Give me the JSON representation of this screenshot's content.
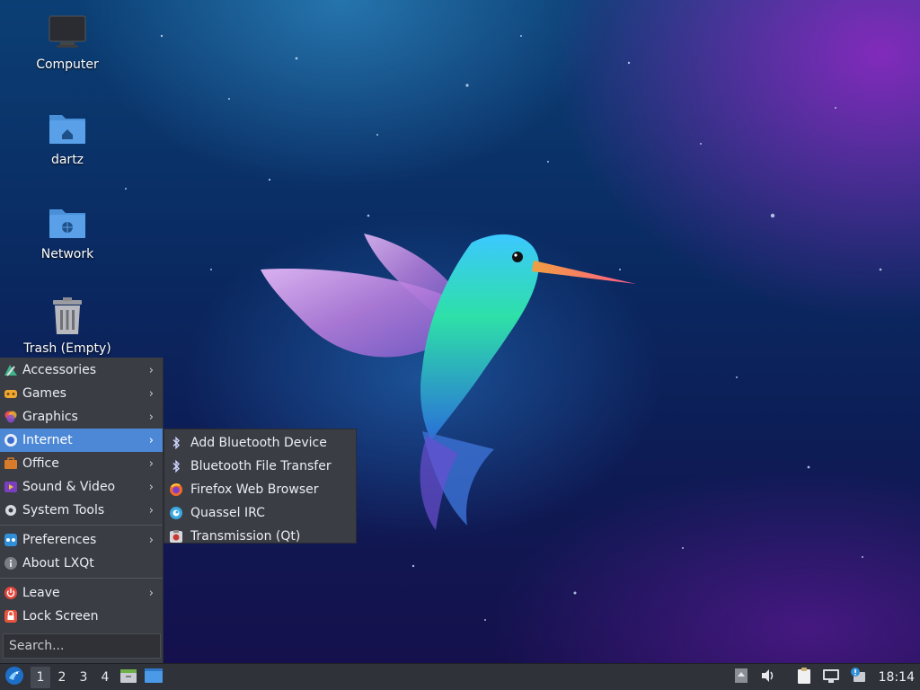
{
  "desktop": {
    "icons": [
      {
        "label": "Computer",
        "icon": "computer-icon"
      },
      {
        "label": "dartz",
        "icon": "home-folder-icon"
      },
      {
        "label": "Network",
        "icon": "network-folder-icon"
      },
      {
        "label": "Trash (Empty)",
        "icon": "trash-icon"
      }
    ]
  },
  "menu": {
    "items": [
      {
        "label": "Accessories",
        "icon": "accessories-icon",
        "submenu": true
      },
      {
        "label": "Games",
        "icon": "games-icon",
        "submenu": true
      },
      {
        "label": "Graphics",
        "icon": "graphics-icon",
        "submenu": true
      },
      {
        "label": "Internet",
        "icon": "internet-icon",
        "submenu": true,
        "active": true
      },
      {
        "label": "Office",
        "icon": "office-icon",
        "submenu": true
      },
      {
        "label": "Sound & Video",
        "icon": "sound-video-icon",
        "submenu": true
      },
      {
        "label": "System Tools",
        "icon": "system-tools-icon",
        "submenu": true
      },
      {
        "label": "Preferences",
        "icon": "preferences-icon",
        "submenu": true
      },
      {
        "label": "About LXQt",
        "icon": "info-icon",
        "submenu": false
      },
      {
        "label": "Leave",
        "icon": "power-icon",
        "submenu": true
      },
      {
        "label": "Lock Screen",
        "icon": "lock-icon",
        "submenu": false
      }
    ],
    "search_placeholder": "Search..."
  },
  "submenu_internet": {
    "items": [
      {
        "label": "Add Bluetooth Device",
        "icon": "bluetooth-icon"
      },
      {
        "label": "Bluetooth File Transfer",
        "icon": "bluetooth-icon"
      },
      {
        "label": "Firefox Web Browser",
        "icon": "firefox-icon"
      },
      {
        "label": "Quassel IRC",
        "icon": "quassel-icon"
      },
      {
        "label": "Transmission (Qt)",
        "icon": "transmission-icon"
      }
    ]
  },
  "taskbar": {
    "workspaces": [
      "1",
      "2",
      "3",
      "4"
    ],
    "current_workspace": "1",
    "clock": "18:14"
  },
  "colors": {
    "menu_bg": "#3a3d44",
    "menu_highlight": "#4c88d6",
    "taskbar_bg": "#30323a"
  }
}
